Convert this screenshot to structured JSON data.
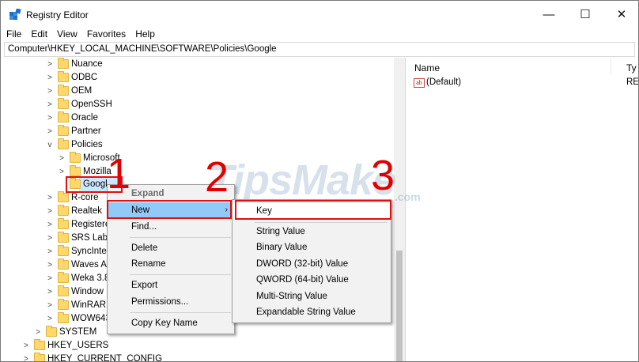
{
  "window": {
    "title": "Registry Editor",
    "minimize_glyph": "—",
    "maximize_glyph": "☐",
    "close_glyph": "✕"
  },
  "menu": [
    "File",
    "Edit",
    "View",
    "Favorites",
    "Help"
  ],
  "address": "Computer\\HKEY_LOCAL_MACHINE\\SOFTWARE\\Policies\\Google",
  "tree": {
    "nuance": "Nuance",
    "odbc": "ODBC",
    "oem": "OEM",
    "openssh": "OpenSSH",
    "oracle": "Oracle",
    "partner": "Partner",
    "policies": "Policies",
    "microsoft": "Microsoft",
    "mozilla": "Mozilla",
    "google": "Googl",
    "rcore": "R-core",
    "realtek": "Realtek",
    "registered": "Registere",
    "srslabs": "SRS Labs",
    "syncintegration": "SyncInte",
    "wavesaudio": "Waves A",
    "weka": "Weka 3.8",
    "windows": "Window",
    "winrar": "WinRAR",
    "wow6432": "WOW643",
    "system": "SYSTEM",
    "hkey_users": "HKEY_USERS",
    "hkey_current_config": "HKEY_CURRENT_CONFIG"
  },
  "values_pane": {
    "col_name": "Name",
    "col_type": "Ty",
    "default_icon": "ab",
    "default_name": "(Default)",
    "default_type": "RE"
  },
  "context_menu": {
    "expand": "Expand",
    "new": "New",
    "find": "Find...",
    "delete": "Delete",
    "rename": "Rename",
    "export": "Export",
    "permissions": "Permissions...",
    "copy_key_name": "Copy Key Name",
    "submenu_arrow": "›"
  },
  "new_submenu": {
    "key": "Key",
    "string_value": "String Value",
    "binary_value": "Binary Value",
    "dword_value": "DWORD (32-bit) Value",
    "qword_value": "QWORD (64-bit) Value",
    "multi_string_value": "Multi-String Value",
    "expandable_string_value": "Expandable String Value"
  },
  "annotations": {
    "step1": "1",
    "step2": "2",
    "step3": "3",
    "watermark": "TipsMake",
    "watermark_suffix": ".com",
    "highlight_color": "#e01010"
  }
}
